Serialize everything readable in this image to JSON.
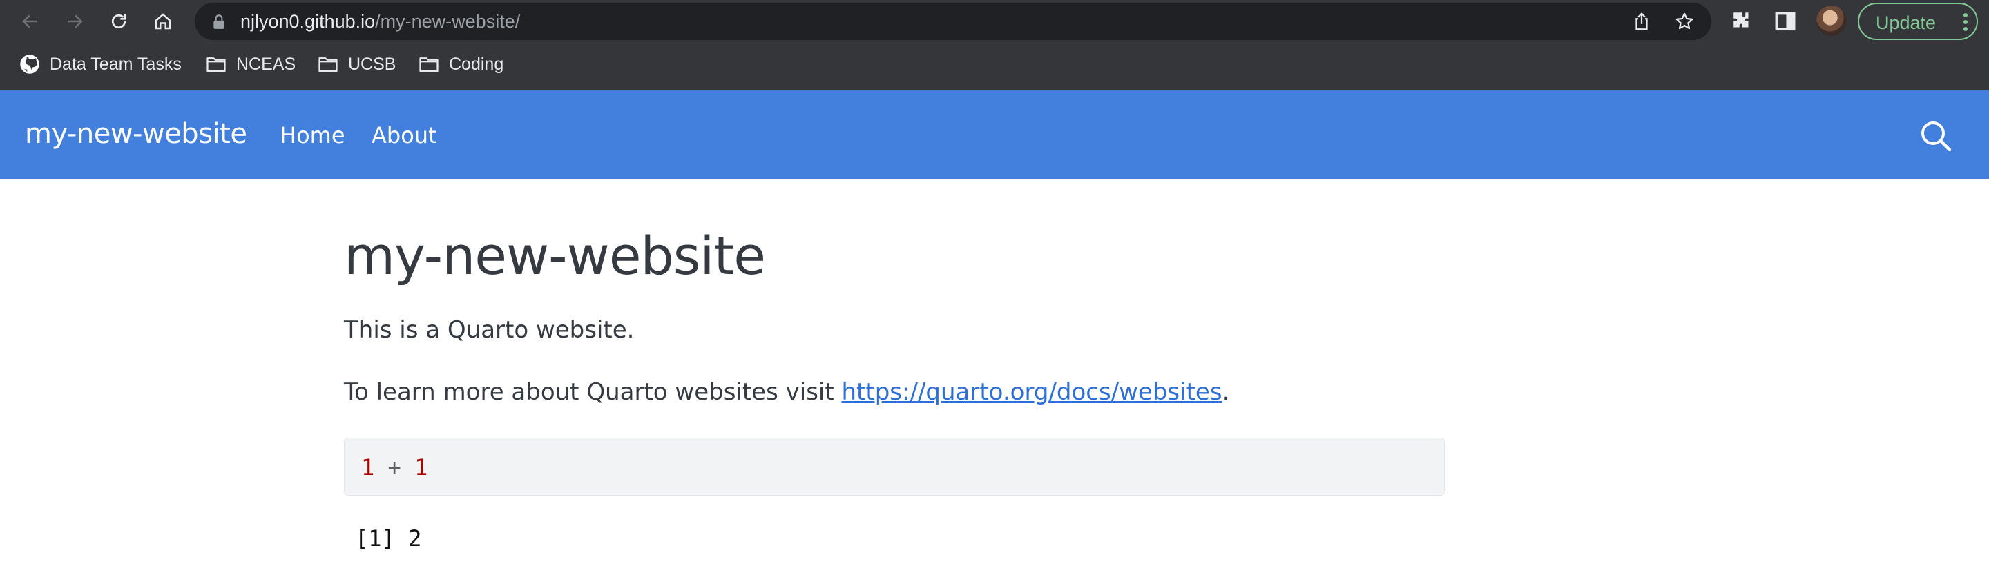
{
  "browser": {
    "url_host": "njlyon0.github.io",
    "url_path": "/my-new-website/",
    "update_label": "Update",
    "bookmarks": [
      {
        "label": "Data Team Tasks",
        "icon": "github-icon"
      },
      {
        "label": "NCEAS",
        "icon": "folder-icon"
      },
      {
        "label": "UCSB",
        "icon": "folder-icon"
      },
      {
        "label": "Coding",
        "icon": "folder-icon"
      }
    ],
    "colors": {
      "chrome": "#35363a",
      "omnibox": "#202124",
      "update_accent": "#81c995"
    }
  },
  "navbar": {
    "brand": "my-new-website",
    "links": [
      {
        "label": "Home"
      },
      {
        "label": "About"
      }
    ],
    "color": "#4380dd"
  },
  "main": {
    "title": "my-new-website",
    "intro": "This is a Quarto website.",
    "learn_prefix": "To learn more about Quarto websites visit ",
    "learn_link": "https://quarto.org/docs/websites",
    "learn_suffix": ".",
    "code": {
      "left": "1",
      "op": "+",
      "right": "1"
    },
    "output": "[1] 2",
    "link_color": "#2e6fd7"
  }
}
